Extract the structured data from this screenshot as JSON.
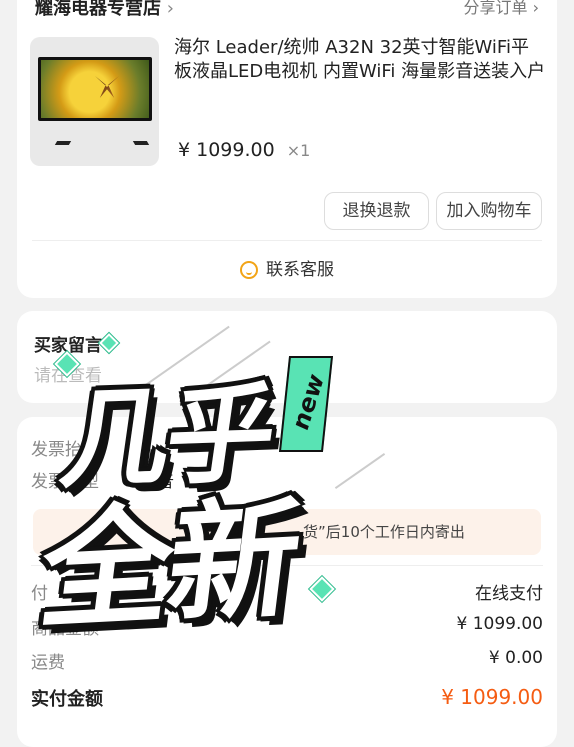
{
  "store": {
    "name": "耀海电器专营店",
    "share_label": "分享订单"
  },
  "product": {
    "title": "海尔 Leader/统帅 A32N 32英寸智能WiFi平板液晶LED电视机 内置WiFi 海量影音送装入户",
    "price": "¥ 1099.00",
    "qty": "×1"
  },
  "actions": {
    "refund_label": "退换退款",
    "cart_label": "加入购物车"
  },
  "service": {
    "label": "联系客服",
    "icon": "customer-service-icon"
  },
  "message": {
    "title": "买家留言",
    "placeholder": "请在查看"
  },
  "invoice": {
    "title_label": "发票抬头",
    "type_label": "发票类型",
    "type_value": "普"
  },
  "notice": {
    "text": "货”后10个工作日内寄出"
  },
  "payment": {
    "method_label": "付",
    "method_value": "在线支付",
    "goods_label": "商品金额",
    "goods_value": "¥ 1099.00",
    "shipping_label": "运费",
    "shipping_value": "¥ 0.00",
    "total_label": "实付金额",
    "total_value": "¥ 1099.00"
  },
  "overlay": {
    "line1": "几乎",
    "line2": "全新",
    "tag": "new",
    "tag_color": "#59e3b4"
  },
  "colors": {
    "accent_orange": "#f55c12",
    "service_yellow": "#f2a417"
  }
}
